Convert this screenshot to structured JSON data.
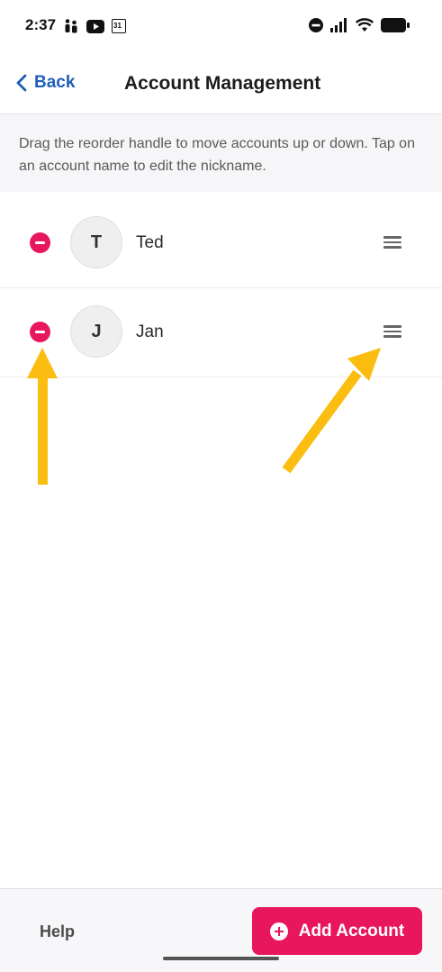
{
  "status_bar": {
    "time": "2:37",
    "left_icons": [
      "people-icon",
      "youtube-icon",
      "calendar-icon"
    ],
    "calendar_day": "31",
    "right_icons": [
      "do-not-disturb-icon",
      "signal-icon",
      "wifi-icon",
      "battery-icon"
    ]
  },
  "header": {
    "back_label": "Back",
    "title": "Account Management"
  },
  "instructions": "Drag the reorder handle to move accounts up or down. Tap on an account name to edit the nickname.",
  "accounts": [
    {
      "initial": "T",
      "name": "Ted"
    },
    {
      "initial": "J",
      "name": "Jan"
    }
  ],
  "footer": {
    "help_label": "Help",
    "add_account_label": "Add Account"
  },
  "colors": {
    "accent": "#e8175d",
    "link": "#1f5fb6",
    "annotation_arrow": "#fbbd10"
  }
}
